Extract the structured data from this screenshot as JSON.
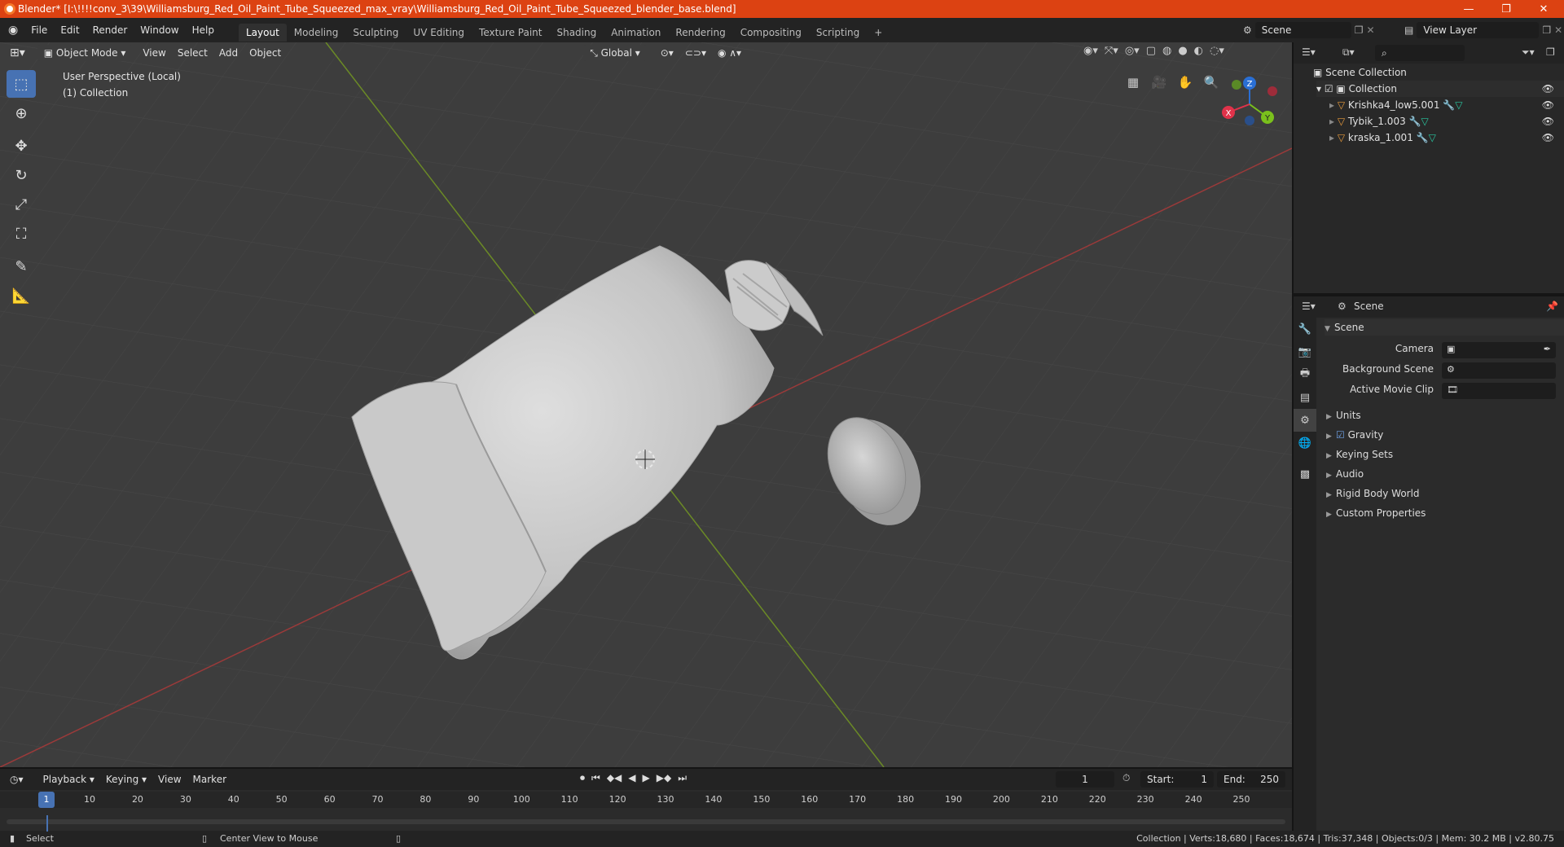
{
  "titlebar": {
    "title": "Blender* [I:\\!!!!conv_3\\39\\Williamsburg_Red_Oil_Paint_Tube_Squeezed_max_vray\\Williamsburg_Red_Oil_Paint_Tube_Squeezed_blender_base.blend]",
    "minimize": "—",
    "maximize": "❐",
    "close": "✕"
  },
  "menu": [
    "File",
    "Edit",
    "Render",
    "Window",
    "Help"
  ],
  "workspaces": [
    "Layout",
    "Modeling",
    "Sculpting",
    "UV Editing",
    "Texture Paint",
    "Shading",
    "Animation",
    "Rendering",
    "Compositing",
    "Scripting"
  ],
  "add_workspace": "+",
  "scene_selector": "Scene",
  "view_layer_selector": "View Layer",
  "viewport_header": {
    "mode": "Object Mode",
    "menus": [
      "View",
      "Select",
      "Add",
      "Object"
    ],
    "orientation": "Global"
  },
  "viewport_info": {
    "line1": "User Perspective (Local)",
    "line2": "(1) Collection"
  },
  "gizmo": {
    "x": "X",
    "y": "Y",
    "z": "Z"
  },
  "outliner": {
    "root": "Scene Collection",
    "collection": "Collection",
    "items": [
      "Krishka4_low5.001",
      "Tybik_1.003",
      "kraska_1.001"
    ]
  },
  "properties": {
    "header": "Scene",
    "section": "Scene",
    "fields": [
      {
        "label": "Camera"
      },
      {
        "label": "Background Scene"
      },
      {
        "label": "Active Movie Clip"
      }
    ],
    "subsections": [
      "Units",
      "Gravity",
      "Keying Sets",
      "Audio",
      "Rigid Body World",
      "Custom Properties"
    ]
  },
  "timeline": {
    "menus": [
      "Playback",
      "Keying",
      "View",
      "Marker"
    ],
    "current_frame": "1",
    "start_label": "Start:",
    "start_value": "1",
    "end_label": "End:",
    "end_value": "250",
    "ticks": [
      "1",
      "10",
      "20",
      "30",
      "40",
      "50",
      "60",
      "70",
      "80",
      "90",
      "100",
      "110",
      "120",
      "130",
      "140",
      "150",
      "160",
      "170",
      "180",
      "190",
      "200",
      "210",
      "220",
      "230",
      "240",
      "250"
    ]
  },
  "statusbar": {
    "left": "Select",
    "middle": "Center View to Mouse",
    "right": "Collection | Verts:18,680 | Faces:18,674 | Tris:37,348 | Objects:0/3 | Mem: 30.2 MB | v2.80.75"
  }
}
